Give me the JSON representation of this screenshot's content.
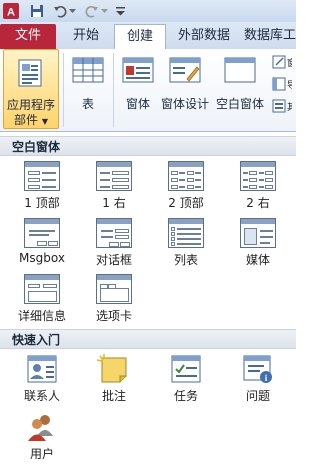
{
  "tabs": {
    "file": "文件",
    "home": "开始",
    "create": "创建",
    "external": "外部数据",
    "dbtools": "数据库工"
  },
  "ribbon": {
    "app_parts": "应用程序",
    "app_parts2": "部件",
    "table": "表",
    "form": "窗体",
    "form_design": "窗体设计",
    "blank_form": "空白窗体"
  },
  "gallery": {
    "blank_forms_header": "空白窗体",
    "quick_start_header": "快速入门",
    "blank_forms": [
      "1 顶部",
      "1 右",
      "2 顶部",
      "2 右",
      "Msgbox",
      "对话框",
      "列表",
      "媒体",
      "详细信息",
      "选项卡"
    ],
    "quick_start": [
      "联系人",
      "批注",
      "任务",
      "问题",
      "用户"
    ]
  },
  "colors": {
    "access_red": "#b7263a",
    "ribbon_blue": "#dde8f5",
    "highlight": "#ffe08a"
  }
}
